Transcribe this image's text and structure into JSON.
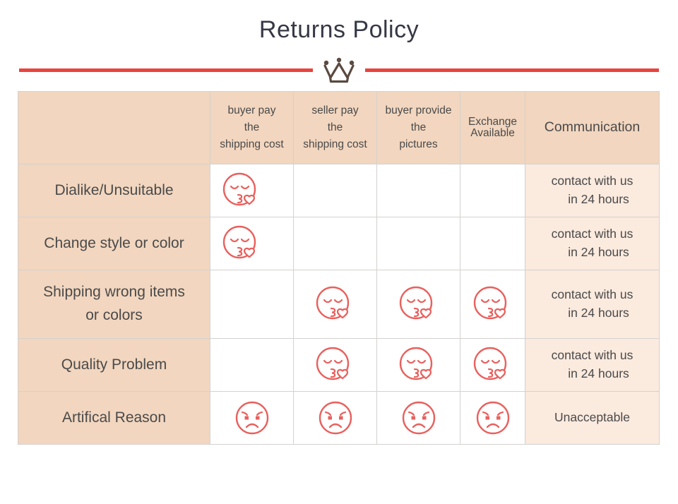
{
  "header": {
    "title": "Returns Policy",
    "crown_icon": "crown-icon",
    "divider_color": "#e8443f",
    "crown_color": "#5b4a40"
  },
  "theme": {
    "header_bg": "#f2d6bf",
    "label_bg": "#f2d6bf",
    "cell_bg": "#ffffff",
    "comm_bg": "#fbeade",
    "grid_line": "#d4d2d0",
    "emoji_color": "#e8615e",
    "text_color": "#4a4a4a",
    "title_color": "#363845"
  },
  "table": {
    "columns": [
      {
        "key": "label",
        "label": ""
      },
      {
        "key": "buyer_pay",
        "line1": "buyer pay",
        "line2": "the",
        "line3": "shipping cost"
      },
      {
        "key": "seller_pay",
        "line1": "seller pay",
        "line2": "the",
        "line3": "shipping cost"
      },
      {
        "key": "buyer_pictures",
        "line1": "buyer provide",
        "line2": "the",
        "line3": "pictures"
      },
      {
        "key": "exchange",
        "line1": "Exchange",
        "line2": "Available"
      },
      {
        "key": "communication",
        "label": "Communication"
      }
    ],
    "rows": [
      {
        "label": "Dialike/Unsuitable",
        "label_line2": "",
        "buyer_pay": "kiss-face-icon",
        "seller_pay": "",
        "buyer_pictures": "",
        "exchange": "",
        "communication_line1": "contact with us",
        "communication_line2": "in 24 hours"
      },
      {
        "label": "Change style or color",
        "label_line2": "",
        "buyer_pay": "kiss-face-icon",
        "seller_pay": "",
        "buyer_pictures": "",
        "exchange": "",
        "communication_line1": "contact with us",
        "communication_line2": "in 24 hours"
      },
      {
        "label": "Shipping wrong items",
        "label_line2": "or colors",
        "buyer_pay": "",
        "seller_pay": "kiss-face-icon",
        "buyer_pictures": "kiss-face-icon",
        "exchange": "kiss-face-icon",
        "communication_line1": "contact with us",
        "communication_line2": "in 24 hours"
      },
      {
        "label": "Quality Problem",
        "label_line2": "",
        "buyer_pay": "",
        "seller_pay": "kiss-face-icon",
        "buyer_pictures": "kiss-face-icon",
        "exchange": "kiss-face-icon",
        "communication_line1": "contact with us",
        "communication_line2": "in 24 hours"
      },
      {
        "label": "Artifical Reason",
        "label_line2": "",
        "buyer_pay": "sad-face-icon",
        "seller_pay": "sad-face-icon",
        "buyer_pictures": "sad-face-icon",
        "exchange": "sad-face-icon",
        "communication_line1": "Unacceptable",
        "communication_line2": ""
      }
    ]
  }
}
